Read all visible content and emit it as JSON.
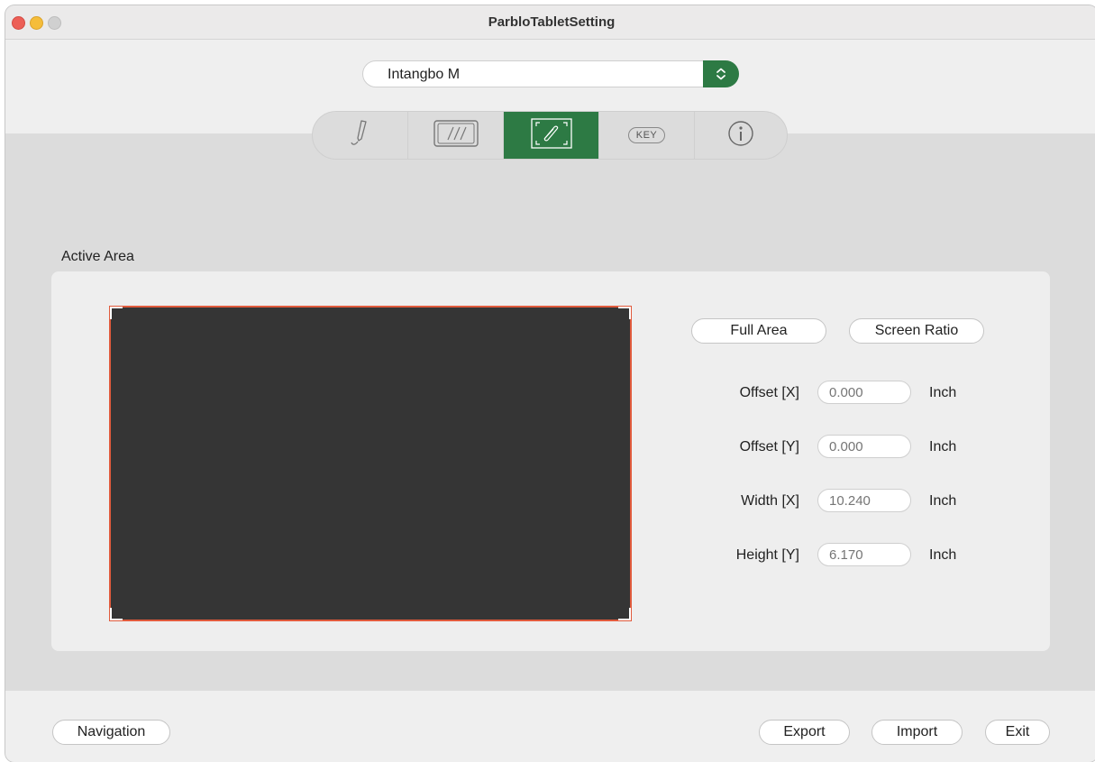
{
  "window": {
    "title": "ParbloTabletSetting"
  },
  "device": {
    "selected": "Intangbo M"
  },
  "tabs": [
    {
      "name": "pen-tab",
      "icon": "pen-icon",
      "active": false
    },
    {
      "name": "tablet-tab",
      "icon": "tablet-icon",
      "active": false
    },
    {
      "name": "mapping-tab",
      "icon": "area-mapping-icon",
      "active": true
    },
    {
      "name": "key-tab",
      "icon": "key-icon",
      "label": "KEY",
      "active": false
    },
    {
      "name": "info-tab",
      "icon": "info-icon",
      "active": false
    }
  ],
  "active_area": {
    "label": "Active Area",
    "full_area_label": "Full Area",
    "screen_ratio_label": "Screen Ratio",
    "rows": [
      {
        "label": "Offset [X]",
        "value": "0.000",
        "unit": "Inch"
      },
      {
        "label": "Offset [Y]",
        "value": "0.000",
        "unit": "Inch"
      },
      {
        "label": "Width [X]",
        "value": "10.240",
        "unit": "Inch"
      },
      {
        "label": "Height [Y]",
        "value": "6.170",
        "unit": "Inch"
      }
    ]
  },
  "footer": {
    "navigation_label": "Navigation",
    "export_label": "Export",
    "import_label": "Import",
    "exit_label": "Exit"
  },
  "colors": {
    "accent": "#2d7a44",
    "area_border": "#e05a3c",
    "area_fill": "#353535"
  }
}
